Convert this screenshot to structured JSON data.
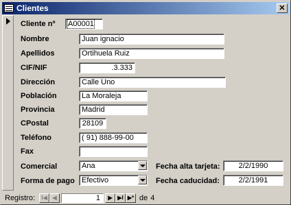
{
  "window": {
    "title": "Clientes",
    "close_glyph": "✕",
    "title_icon": "form-icon"
  },
  "form": {
    "cliente_label": "Cliente nº",
    "cliente_value": "A00001",
    "nombre_label": "Nombre",
    "nombre_value": "Juan ignacio",
    "apellidos_label": "Apellidos",
    "apellidos_value": "Ortihuela Ruiz",
    "cif_label": "CIF/NIF",
    "cif_value": ".3.333",
    "direccion_label": "Dirección",
    "direccion_value": "Calle Uno",
    "poblacion_label": "Población",
    "poblacion_value": "La Moraleja",
    "provincia_label": "Provincia",
    "provincia_value": "Madrid",
    "cpostal_label": "CPostal",
    "cpostal_value": "28109",
    "telefono_label": "Teléfono",
    "telefono_value": "( 91) 888-99-00",
    "fax_label": "Fax",
    "fax_value": "",
    "comercial_label": "Comercial",
    "comercial_value": "Ana",
    "forma_pago_label": "Forma de pago",
    "forma_pago_value": "Efectivo",
    "fecha_alta_label": "Fecha alta tarjeta:",
    "fecha_alta_value": "2/2/1990",
    "fecha_cad_label": "Fecha caducidad:",
    "fecha_cad_value": "2/2/1991"
  },
  "navigation": {
    "label": "Registro:",
    "first_glyph": "I◀",
    "prev_glyph": "◀",
    "next_glyph": "▶",
    "last_glyph": "▶I",
    "new_glyph": "▶*",
    "current": "1",
    "of_label": "de",
    "total": "4"
  }
}
